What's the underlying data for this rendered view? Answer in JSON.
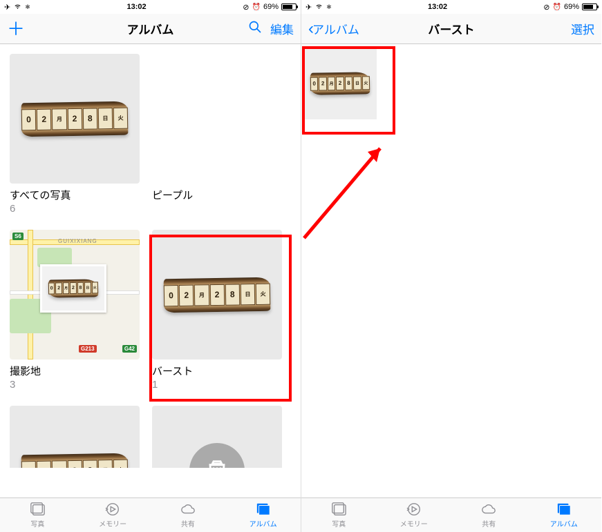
{
  "status": {
    "time": "13:02",
    "battery_pct": "69%",
    "airplane": "✈",
    "wifi": "⋮",
    "loading": "✻",
    "lock": "⦾",
    "alarm": "⏰"
  },
  "left": {
    "nav": {
      "title": "アルバム",
      "edit": "編集"
    },
    "albums": [
      {
        "name": "すべての写真",
        "count": "6"
      },
      {
        "name": "ピープル",
        "count": ""
      },
      {
        "name": "撮影地",
        "count": "3"
      },
      {
        "name": "バースト",
        "count": "1"
      }
    ],
    "map": {
      "label": "GUIXIXIANG",
      "shield1": "S6",
      "shield2": "G213",
      "shield3": "G42"
    }
  },
  "right": {
    "nav": {
      "back": "アルバム",
      "title": "バースト",
      "select": "選択"
    }
  },
  "sign": {
    "t1": "0",
    "t2": "2",
    "m": "月",
    "t3": "2",
    "t4": "8",
    "d": "日",
    "w": "火"
  },
  "tabs": {
    "photos": "写真",
    "memories": "メモリー",
    "shared": "共有",
    "albums": "アルバム"
  }
}
